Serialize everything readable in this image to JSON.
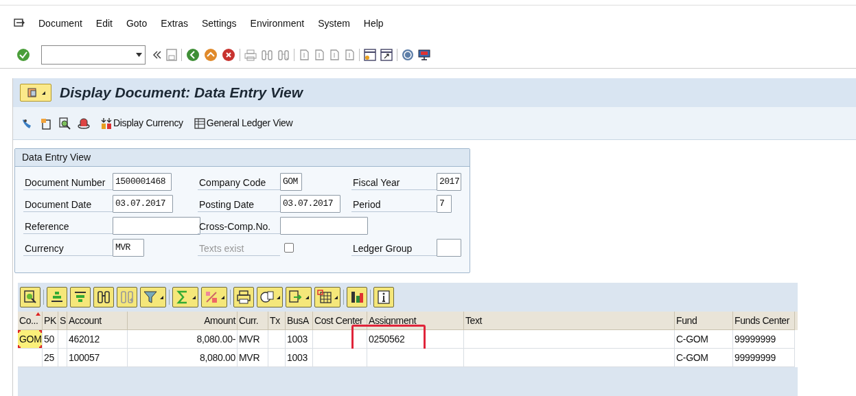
{
  "menu": [
    "Document",
    "Edit",
    "Goto",
    "Extras",
    "Settings",
    "Environment",
    "System",
    "Help"
  ],
  "title": "Display Document: Data Entry View",
  "app_toolbar": [
    {
      "label": "Display Currency"
    },
    {
      "label": "General Ledger View"
    }
  ],
  "group": {
    "title": "Data Entry View",
    "rows": [
      [
        {
          "kind": "field",
          "label": "Document Number",
          "value": "1500001468"
        },
        {
          "kind": "field",
          "label": "Company Code",
          "value": "GOM"
        },
        {
          "kind": "field",
          "label": "Fiscal Year",
          "value": "2017"
        }
      ],
      [
        {
          "kind": "field",
          "label": "Document Date",
          "value": "03.07.2017"
        },
        {
          "kind": "field",
          "label": "Posting Date",
          "value": "03.07.2017"
        },
        {
          "kind": "field",
          "label": "Period",
          "value": "7"
        }
      ],
      [
        {
          "kind": "field",
          "label": "Reference"
        },
        {
          "kind": "field",
          "label": "Cross-Comp.No."
        }
      ],
      [
        {
          "kind": "field",
          "label": "Currency",
          "value": "MVR"
        },
        {
          "kind": "checkbox",
          "label": "Texts exist",
          "disabled": true,
          "checked": false
        },
        {
          "kind": "field",
          "label": "Ledger Group"
        }
      ]
    ]
  },
  "table": {
    "columns": [
      {
        "label": "Co...",
        "sorted": true
      },
      {
        "label": "PK",
        "sorted": false
      },
      {
        "label": "S",
        "sorted": false
      },
      {
        "label": "Account",
        "sorted": false
      },
      {
        "label": "Amount",
        "sorted": false
      },
      {
        "label": "Curr.",
        "sorted": false
      },
      {
        "label": "Tx",
        "sorted": false
      },
      {
        "label": "BusA",
        "sorted": false
      },
      {
        "label": "Cost Center",
        "sorted": false
      },
      {
        "label": "Assignment",
        "sorted": false
      },
      {
        "label": "Text",
        "sorted": false
      },
      {
        "label": "Fund",
        "sorted": false
      },
      {
        "label": "Funds Center",
        "sorted": false
      }
    ],
    "rows": [
      {
        "current": true,
        "highlighted": true,
        "cells": [
          "GOM",
          "50",
          null,
          "462012",
          "8,080.00-",
          "MVR",
          null,
          "1003",
          null,
          "0250562",
          null,
          "C-GOM",
          "99999999"
        ]
      },
      {
        "current": false,
        "highlighted": false,
        "cells": [
          null,
          "25",
          null,
          "100057",
          "8,080.00",
          "MVR",
          null,
          "1003",
          null,
          null,
          null,
          "C-GOM",
          "99999999"
        ]
      }
    ]
  }
}
